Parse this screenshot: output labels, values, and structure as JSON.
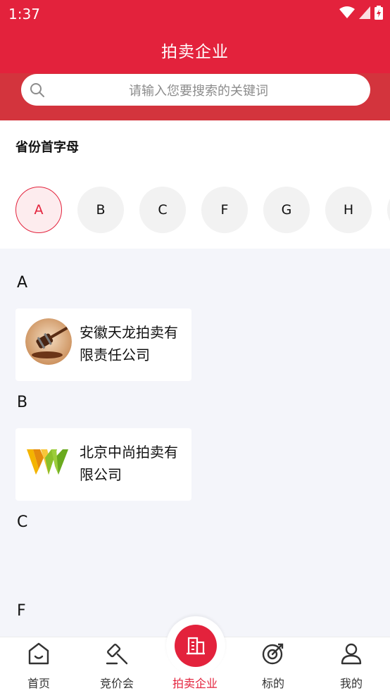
{
  "status_bar": {
    "time": "1:37"
  },
  "header": {
    "title": "拍卖企业"
  },
  "search": {
    "placeholder": "请输入您要搜索的关键词"
  },
  "letters": {
    "title": "省份首字母",
    "items": [
      "A",
      "B",
      "C",
      "F",
      "G",
      "H"
    ],
    "selected": "A"
  },
  "groups": [
    {
      "letter": "A",
      "companies": [
        {
          "name": "安徽天龙拍卖有限责任公司",
          "logo": "gavel-logo"
        }
      ]
    },
    {
      "letter": "B",
      "companies": [
        {
          "name": "北京中尚拍卖有限公司",
          "logo": "vw-logo"
        }
      ]
    },
    {
      "letter": "C",
      "companies": []
    },
    {
      "letter": "F",
      "companies": []
    }
  ],
  "tabbar": {
    "items": [
      {
        "label": "首页",
        "icon": "home-icon"
      },
      {
        "label": "竞价会",
        "icon": "gavel-icon"
      },
      {
        "label": "拍卖企业",
        "icon": "building-icon"
      },
      {
        "label": "标的",
        "icon": "target-icon"
      },
      {
        "label": "我的",
        "icon": "user-icon"
      }
    ],
    "active_index": 2
  },
  "colors": {
    "brand": "#e3223c",
    "search_band": "#d3343d",
    "list_bg": "#f4f5fa"
  }
}
